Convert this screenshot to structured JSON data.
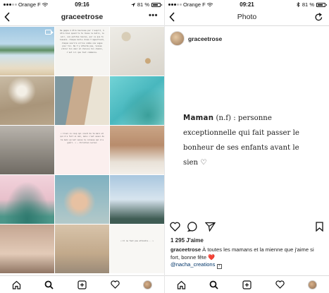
{
  "left_screen": {
    "status": {
      "carrier": "Orange F",
      "time": "09:16",
      "battery": "81 %",
      "battery_level": 0.81
    },
    "header": {
      "back_icon": "chevron-left-icon",
      "username": "graceetrose",
      "more_label": "•••"
    },
    "grid_texts": {
      "p2": "Ne gagne à être heureuse par l'esprit, à être bien quand tu te lèves le matin, le soir, aux petites heures, par ce que tu ressens. Chaque belle chose t'appartient, chaque sourire arrive comme une vague pour toi. Ne t'y attarde pas, laisse vibrer ton cœur et choisis ton chemin, c'est ici que tout commence.",
      "p8": "« Cruel ce coup qui vient de ta main et qui m'a fait si mal, mais c'est aussi de ta main qu'est venue la caresse qui m'a guéri. » — Christian Leroux",
      "p15": "« Il ne faut pas attendre... »"
    },
    "tabbar": [
      "home-icon",
      "search-icon",
      "new-post-icon",
      "heart-icon",
      "profile-avatar"
    ]
  },
  "right_screen": {
    "status": {
      "carrier": "Orange F",
      "time": "09:21",
      "battery": "81 %",
      "battery_level": 0.81
    },
    "header": {
      "title": "Photo",
      "back_icon": "chevron-left-icon",
      "refresh_icon": "refresh-icon"
    },
    "post": {
      "username": "graceetrose",
      "quote_word": "Maman",
      "quote_rest_line1": " (n.f) : personne",
      "quote_line2": "exceptionnelle qui fait passer le",
      "quote_line3": "bonheur de ses enfants avant le",
      "quote_line4": "sien ♡",
      "likes": "1 295 J'aime",
      "caption_user": "graceetrose",
      "caption_text": " À toutes les mamans et la mienne que j'aime si fort, bonne fête ",
      "caption_emoji": "❤️",
      "caption_mention": "@nacha_creations"
    },
    "tabbar": [
      "home-icon",
      "search-icon",
      "new-post-icon",
      "heart-icon",
      "profile-avatar"
    ]
  },
  "colors": {
    "like_red": "#ed4956",
    "mention_blue": "#003569",
    "border": "#dbdbdb"
  }
}
